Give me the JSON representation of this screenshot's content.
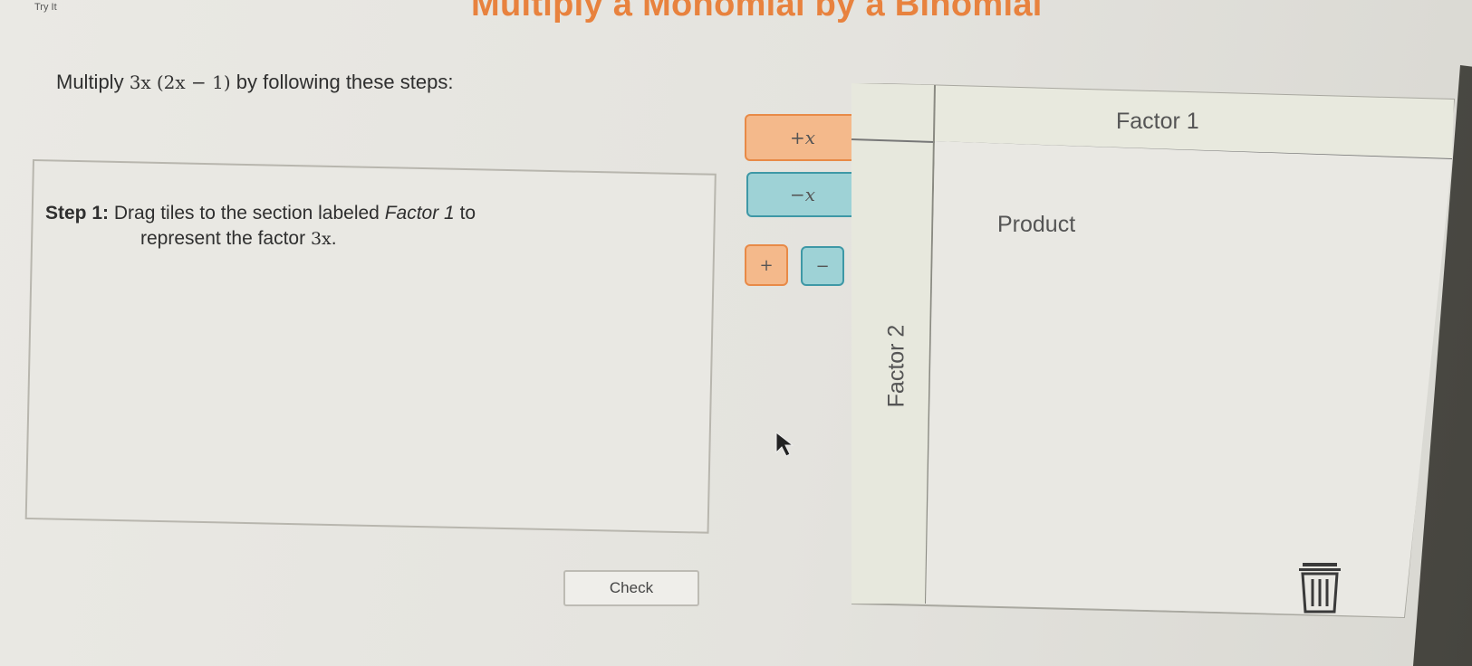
{
  "header": {
    "try_label": "Try It",
    "title": "Multiply a Monomial by a Binomial"
  },
  "prompt": {
    "prefix": "Multiply ",
    "monomial": "3x",
    "binomial": "(2x − 1)",
    "suffix": " by following these steps:"
  },
  "step": {
    "number_label": "Step 1:",
    "text_a": " Drag tiles to the section labeled ",
    "section_name": "Factor 1",
    "text_b": " to",
    "text_c": "represent the factor ",
    "factor": "3x",
    "text_end": "."
  },
  "tiles": {
    "pos_x": "+x",
    "neg_x": "−x",
    "plus": "+",
    "minus": "−"
  },
  "grid": {
    "factor1_label": "Factor 1",
    "factor2_label": "Factor 2",
    "product_label": "Product"
  },
  "buttons": {
    "check": "Check"
  },
  "icons": {
    "trash": "trash-icon",
    "cursor": "mouse-pointer-icon"
  },
  "colors": {
    "title_orange": "#e8823e",
    "positive_tile": "#f4b98b",
    "negative_tile": "#9ed2d6"
  }
}
